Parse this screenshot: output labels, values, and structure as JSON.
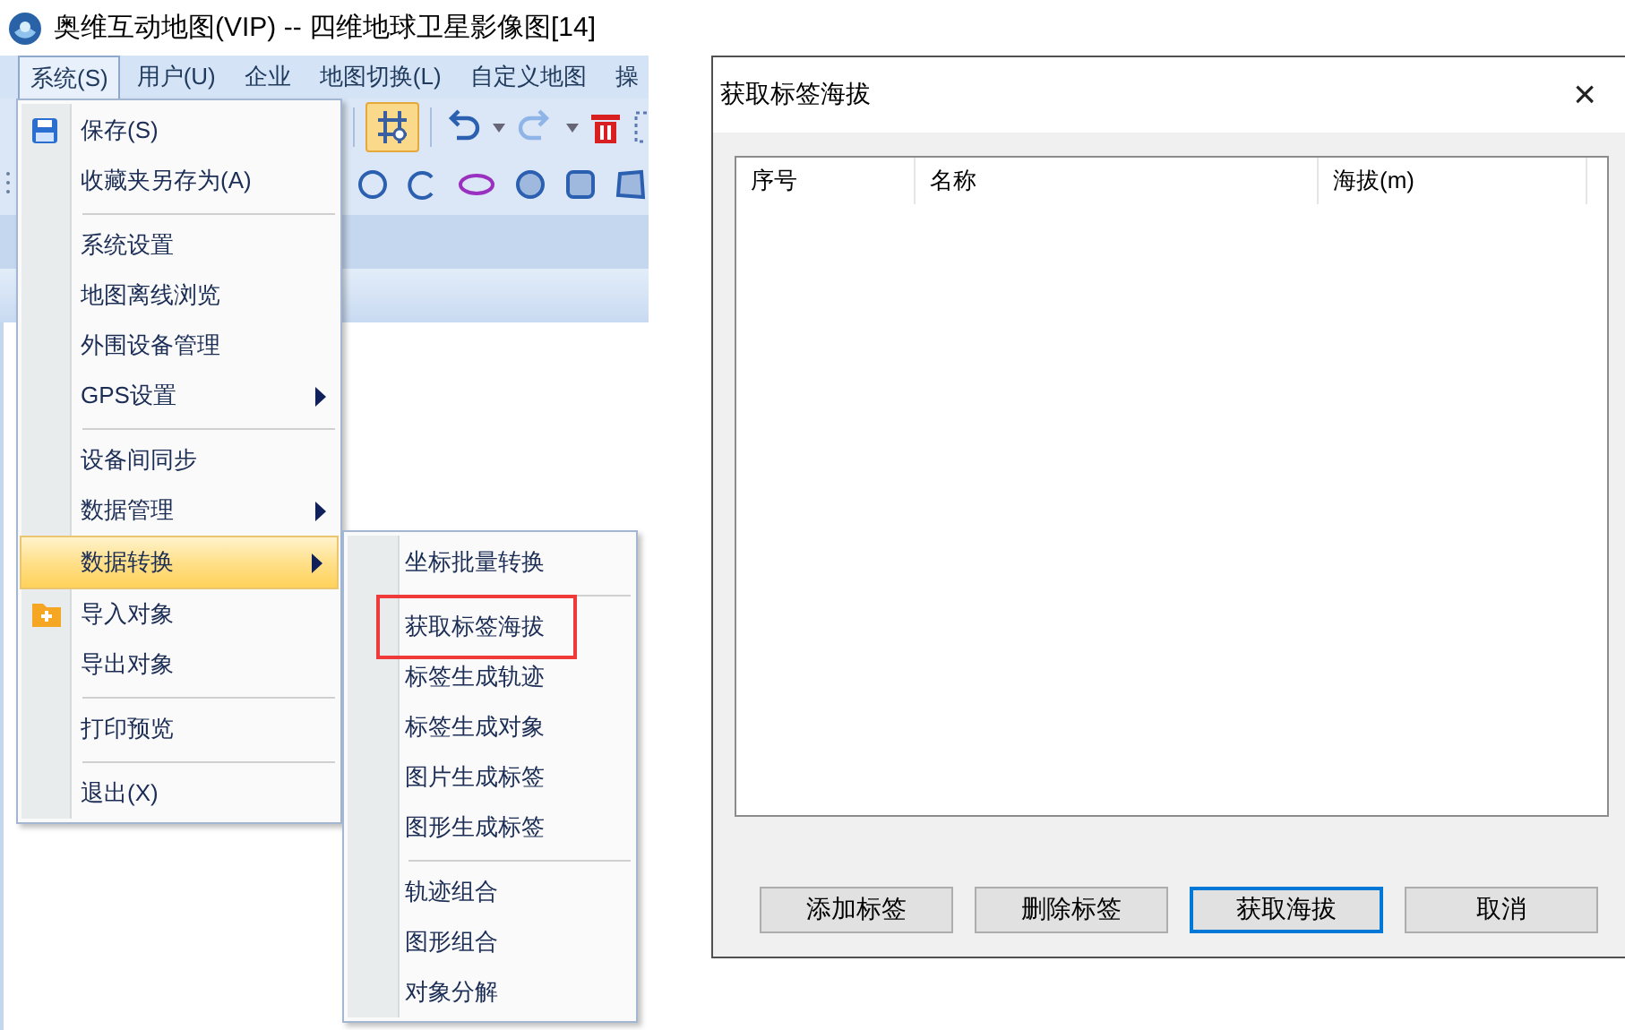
{
  "app": {
    "title": "奥维互动地图(VIP) -- 四维地球卫星影像图[14]",
    "menubar": [
      {
        "label": "系统(S)",
        "selected": true
      },
      {
        "label": "用户(U)",
        "selected": false
      },
      {
        "label": "企业",
        "selected": false
      },
      {
        "label": "地图切换(L)",
        "selected": false
      },
      {
        "label": "自定义地图",
        "selected": false
      },
      {
        "label": "操",
        "selected": false
      }
    ]
  },
  "menu": {
    "items": [
      {
        "kind": "save",
        "label": "保存(S)",
        "selected": false
      },
      {
        "kind": "item",
        "label": "收藏夹另存为(A)",
        "selected": false
      },
      {
        "kind": "separator"
      },
      {
        "kind": "item",
        "label": "系统设置",
        "selected": false
      },
      {
        "kind": "item",
        "label": "地图离线浏览",
        "selected": false
      },
      {
        "kind": "item",
        "label": "外围设备管理",
        "selected": false
      },
      {
        "kind": "submenu",
        "label": "GPS设置",
        "selected": false
      },
      {
        "kind": "separator"
      },
      {
        "kind": "item",
        "label": "设备间同步",
        "selected": false
      },
      {
        "kind": "submenu",
        "label": "数据管理",
        "selected": false
      },
      {
        "kind": "submenu",
        "label": "数据转换",
        "selected": true
      },
      {
        "kind": "import",
        "label": "导入对象",
        "selected": false
      },
      {
        "kind": "item",
        "label": "导出对象",
        "selected": false
      },
      {
        "kind": "separator"
      },
      {
        "kind": "item",
        "label": "打印预览",
        "selected": false
      },
      {
        "kind": "separator"
      },
      {
        "kind": "item",
        "label": "退出(X)",
        "selected": false
      }
    ]
  },
  "submenu": {
    "items": [
      {
        "kind": "item",
        "label": "坐标批量转换",
        "framed": false
      },
      {
        "kind": "separator"
      },
      {
        "kind": "item",
        "label": "获取标签海拔",
        "framed": true
      },
      {
        "kind": "item",
        "label": "标签生成轨迹",
        "framed": false
      },
      {
        "kind": "item",
        "label": "标签生成对象",
        "framed": false
      },
      {
        "kind": "item",
        "label": "图片生成标签",
        "framed": false
      },
      {
        "kind": "item",
        "label": "图形生成标签",
        "framed": false
      },
      {
        "kind": "separator"
      },
      {
        "kind": "item",
        "label": "轨迹组合",
        "framed": false
      },
      {
        "kind": "item",
        "label": "图形组合",
        "framed": false
      },
      {
        "kind": "item",
        "label": "对象分解",
        "framed": false
      }
    ]
  },
  "dialog": {
    "title": "获取标签海拔",
    "close": "×",
    "columns": [
      "序号",
      "名称",
      "海拔(m)"
    ],
    "buttons": [
      {
        "label": "添加标签",
        "focused": false
      },
      {
        "label": "删除标签",
        "focused": false
      },
      {
        "label": "获取海拔",
        "focused": true
      },
      {
        "label": "取消",
        "focused": false
      }
    ]
  }
}
